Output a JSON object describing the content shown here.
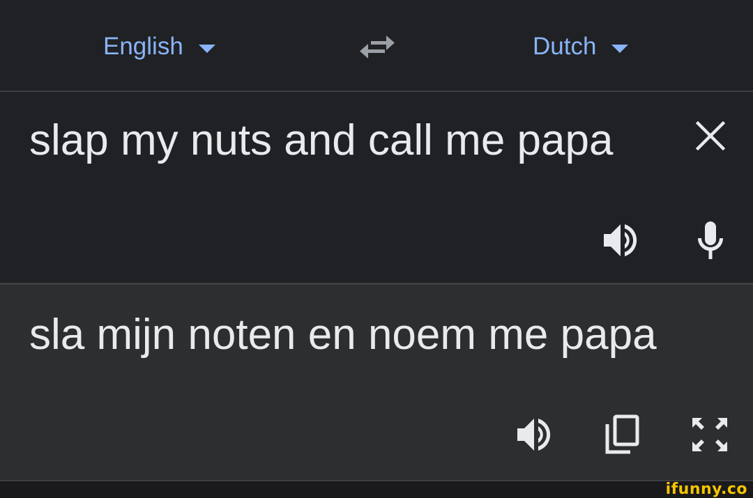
{
  "languages": {
    "source": "English",
    "target": "Dutch"
  },
  "input": {
    "text": "slap my nuts and call me papa"
  },
  "output": {
    "text": "sla mijn noten en noem me papa"
  },
  "icons": {
    "language_dropdown": "caret-down-icon",
    "swap": "swap-arrows-icon",
    "clear": "close-icon",
    "listen_source": "speaker-icon",
    "voice_input": "microphone-icon",
    "listen_target": "speaker-icon",
    "copy": "copy-icon",
    "fullscreen": "fullscreen-icon"
  },
  "watermark": "ifunny.co",
  "colors": {
    "background": "#202124",
    "output_background": "#2d2e30",
    "accent": "#8ab4f8",
    "text": "#e8eaed",
    "icon": "#e8eaed",
    "icon_muted": "#9aa0a6",
    "watermark": "#f5c400"
  }
}
